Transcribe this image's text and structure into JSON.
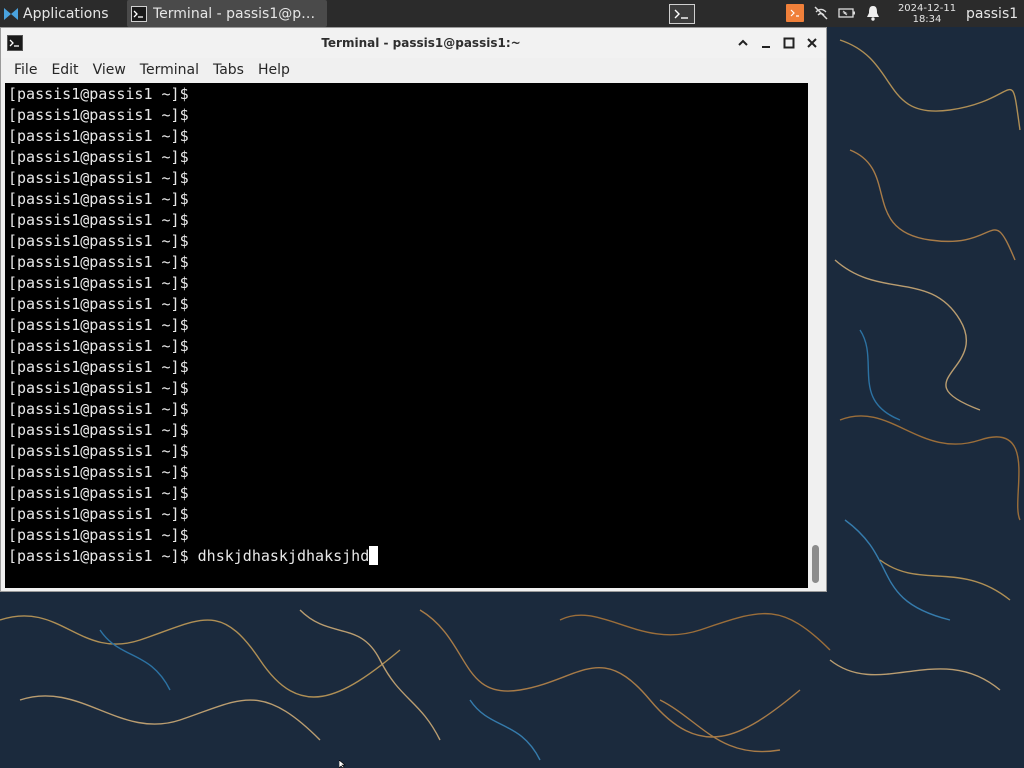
{
  "panel": {
    "apps_label": "Applications",
    "taskbar_label": "Terminal - passis1@p…",
    "clock_date": "2024-12-11",
    "clock_time": "18:34",
    "user": "passis1"
  },
  "window": {
    "title": "Terminal - passis1@passis1:~"
  },
  "menu": {
    "file": "File",
    "edit": "Edit",
    "view": "View",
    "terminal": "Terminal",
    "tabs": "Tabs",
    "help": "Help"
  },
  "terminal": {
    "prompt": "[passis1@passis1 ~]$",
    "prompt_line_count": 23,
    "current_input": "dhskjdhaskjdhaksjhd"
  },
  "colors": {
    "panel_bg": "#2b2b2b",
    "terminal_bg": "#000000",
    "terminal_fg": "#e8e8e8",
    "wallpaper_bg": "#1b2a3d",
    "tray_accent": "#f0803a"
  },
  "icons": [
    "applications-icon",
    "terminal-icon",
    "workspace-icon",
    "notes-icon",
    "network-off-icon",
    "battery-icon",
    "notification-bell-icon",
    "minimize-icon",
    "maximize-icon",
    "close-icon",
    "chevron-up-icon"
  ]
}
